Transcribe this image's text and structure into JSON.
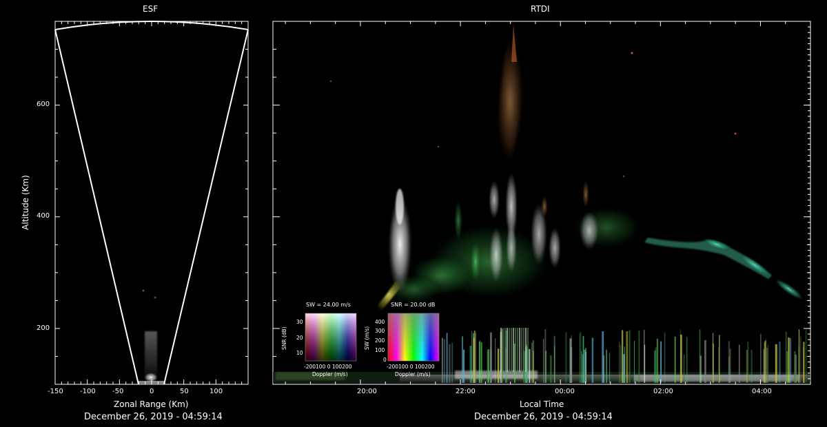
{
  "esf": {
    "title": "ESF",
    "xlabel": "Zonal Range (Km)",
    "ylabel": "Altitude (Km)",
    "date": "December 26, 2019 - 04:59:14",
    "xticks": [
      "-150",
      "-100",
      "-50",
      "0",
      "50",
      "100"
    ],
    "yticks": [
      "200",
      "400",
      "600"
    ]
  },
  "rtdi": {
    "title": "RTDI",
    "xlabel": "Local Time",
    "date": "December 26, 2019 - 04:59:14",
    "xticks": [
      "20:00",
      "22:00",
      "00:00",
      "02:00",
      "04:00"
    ]
  },
  "legend_sw": {
    "title": "SW = 24.00 m/s",
    "ylabel": "SNR (dB)",
    "xlabel": "Doppler (m/s)",
    "yticks": [
      "30",
      "20",
      "10"
    ],
    "xticks": "-200100  0  100200"
  },
  "legend_snr": {
    "title": "SNR = 20.00 dB",
    "ylabel": "SW (m/s)",
    "xlabel": "Doppler (m/s)",
    "yticks": [
      "400",
      "300",
      "200",
      "100",
      "0"
    ],
    "xticks": "-200100  0  100200"
  },
  "chart_data": [
    {
      "type": "heatmap",
      "title": "ESF",
      "xlabel": "Zonal Range (Km)",
      "ylabel": "Altitude (Km)",
      "xlim": [
        -150,
        150
      ],
      "ylim": [
        100,
        750
      ],
      "x_ticks": [
        -150,
        -100,
        -50,
        0,
        50,
        100
      ],
      "y_ticks": [
        200,
        400,
        600
      ],
      "beam_fan": {
        "left_edge_km": [
          -19,
          100
        ],
        "right_edge_km": [
          19,
          100
        ],
        "top_left_km": [
          -150,
          737
        ],
        "top_right_km": [
          150,
          737
        ]
      },
      "echoes": [
        {
          "x": 0,
          "y_range": [
            100,
            195
          ],
          "color": "#e0e0e0"
        }
      ]
    },
    {
      "type": "heatmap",
      "title": "RTDI",
      "xlabel": "Local Time",
      "ylabel": "Altitude (Km)",
      "xlim": [
        "18:15",
        "05:00"
      ],
      "ylim": [
        100,
        750
      ],
      "x_ticks": [
        "20:00",
        "22:00",
        "00:00",
        "02:00",
        "04:00"
      ],
      "y_ticks": [
        200,
        400,
        600
      ],
      "plumes": [
        {
          "t": 20.8,
          "alt_range": [
            240,
            360
          ],
          "color": "#e8e8e8"
        },
        {
          "t": 20.45,
          "alt_range": [
            215,
            255
          ],
          "color": "#c8c040"
        },
        {
          "t": 22.7,
          "alt_range": [
            300,
            640
          ],
          "color": "#8a8a70"
        },
        {
          "t": 22.95,
          "alt_range": [
            390,
            750
          ],
          "color": "#b07850"
        },
        {
          "t": 23.0,
          "alt_range": [
            250,
            350
          ],
          "color": "#c0c0b0"
        },
        {
          "t": 23.6,
          "alt_range": [
            250,
            340
          ],
          "color": "#d8d8c8"
        },
        {
          "t": 23.9,
          "alt_range": [
            250,
            330
          ],
          "color": "#c0c0b0"
        },
        {
          "t": 0.55,
          "alt_range": [
            300,
            360
          ],
          "color": "#d0d0c0"
        },
        {
          "t": 0.6,
          "alt_range": [
            360,
            440
          ],
          "color": "#b07850"
        },
        {
          "t": 3.0,
          "alt_range": [
            310,
            360
          ],
          "color": "#40c8a0"
        },
        {
          "t": 4.2,
          "alt_range": [
            215,
            260
          ],
          "color": "#40c890"
        }
      ]
    }
  ]
}
